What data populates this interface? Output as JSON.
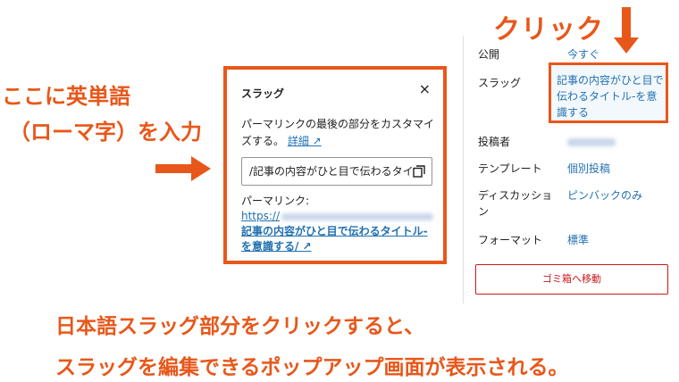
{
  "annotations": {
    "click": "クリック",
    "left_line1": "ここに英単語",
    "left_line2": "（ローマ字）を入力",
    "bottom_line1": "日本語スラッグ部分をクリックすると、",
    "bottom_line2": "スラッグを編集できるポップアップ画面が表示される。"
  },
  "popup": {
    "title": "スラッグ",
    "close": "×",
    "description": "パーマリンクの最後の部分をカスタマイズする。",
    "details_link": "詳細 ↗",
    "input_value": "/記事の内容がひと目で伝わるタイ",
    "permalink_label": "パーマリンク:",
    "permalink_host": "https://",
    "permalink_slug": "記事の内容がひと目で伝わるタイトル-を意識する/ ↗"
  },
  "sidebar": {
    "publish_label": "公開",
    "publish_value": "今すぐ",
    "slug_label": "スラッグ",
    "slug_value": "記事の内容がひと目で伝わるタイトル-を意識する",
    "author_label": "投稿者",
    "template_label": "テンプレート",
    "template_value": "個別投稿",
    "discussion_label": "ディスカッション",
    "discussion_value": "ピンバックのみ",
    "format_label": "フォーマット",
    "format_value": "標準",
    "trash_button": "ゴミ箱へ移動"
  },
  "colors": {
    "annotation": "#e8571a",
    "link": "#2271b1",
    "danger": "#cc1818"
  }
}
